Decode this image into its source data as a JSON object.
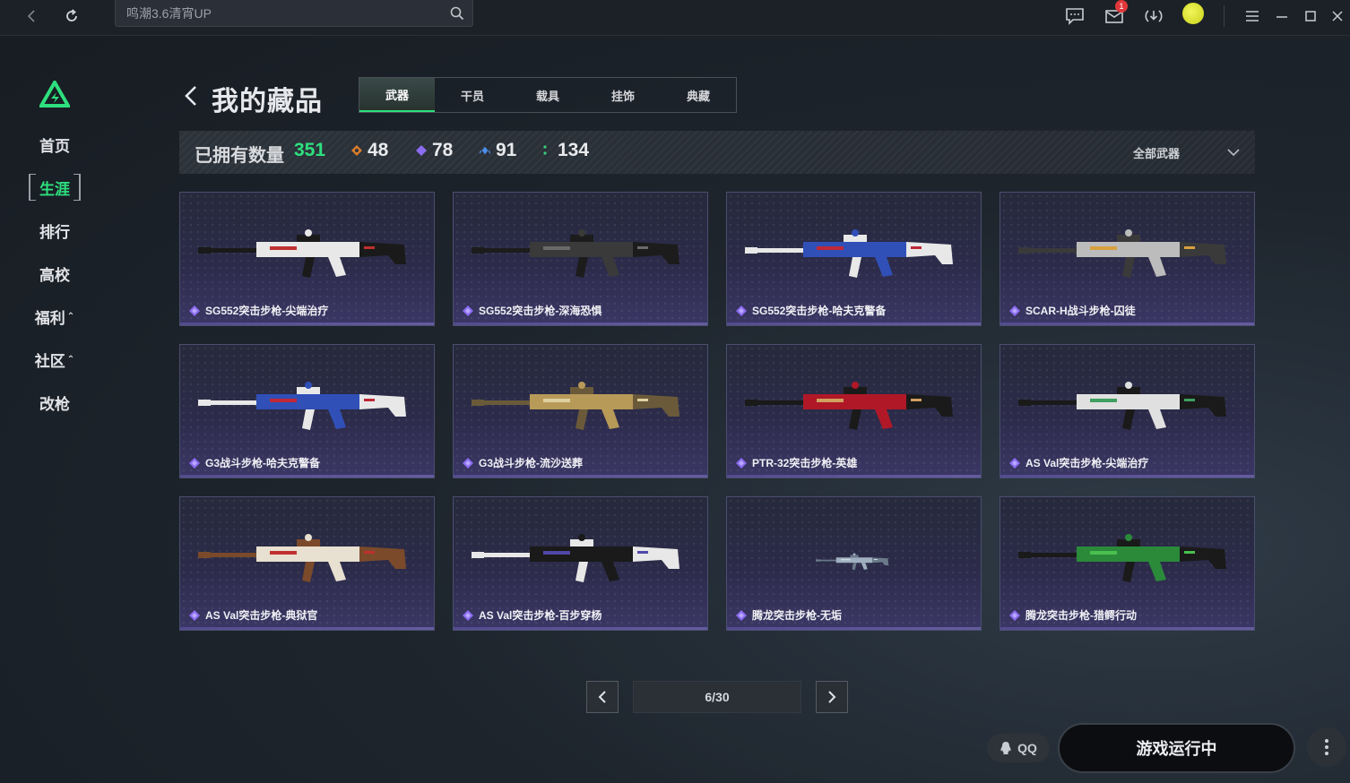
{
  "topbar": {
    "search_value": "鸣潮3.6清宵UP",
    "notification_count": "1",
    "icons": [
      "back-arrow-icon",
      "refresh-icon",
      "search-icon",
      "chat-icon",
      "mail-icon",
      "download-icon",
      "avatar",
      "menu-icon",
      "minimize-icon",
      "maximize-icon",
      "close-icon"
    ]
  },
  "sidebar": {
    "items": [
      {
        "label": "首页",
        "active": false,
        "caret": ""
      },
      {
        "label": "生涯",
        "active": true,
        "caret": ""
      },
      {
        "label": "排行",
        "active": false,
        "caret": ""
      },
      {
        "label": "高校",
        "active": false,
        "caret": ""
      },
      {
        "label": "福利",
        "active": false,
        "caret": "⌃"
      },
      {
        "label": "社区",
        "active": false,
        "caret": "⌃"
      },
      {
        "label": "改枪",
        "active": false,
        "caret": ""
      }
    ]
  },
  "header": {
    "title": "我的藏品",
    "tabs": [
      "武器",
      "干员",
      "载具",
      "挂饰",
      "典藏"
    ],
    "active_tab": "武器"
  },
  "stats": {
    "owned_label": "已拥有数量",
    "owned_total": "351",
    "counts": [
      {
        "value": "48",
        "color": "#d87c2a"
      },
      {
        "value": "78",
        "color": "#8c6cf0"
      },
      {
        "value": "91",
        "color": "#4a8ee8"
      },
      {
        "value": "134",
        "color": "#35d07a"
      }
    ],
    "filter_label": "全部武器"
  },
  "items": [
    {
      "name": "SG552突击步枪-尖端治疗",
      "colors": [
        "#e8e8e8",
        "#1a1a1a",
        "#c03030"
      ]
    },
    {
      "name": "SG552突击步枪-深海恐惧",
      "colors": [
        "#3a3a3a",
        "#1c1c1c",
        "#6a6a6a"
      ]
    },
    {
      "name": "SG552突击步枪-哈夫克警备",
      "colors": [
        "#3050b8",
        "#e8e8e8",
        "#c02838"
      ]
    },
    {
      "name": "SCAR-H战斗步枪-囚徒",
      "colors": [
        "#bcbcbc",
        "#3a3a3a",
        "#d8a040"
      ]
    },
    {
      "name": "G3战斗步枪-哈夫克警备",
      "colors": [
        "#3050b8",
        "#e8e8e8",
        "#c02838"
      ]
    },
    {
      "name": "G3战斗步枪-流沙送葬",
      "colors": [
        "#b89a58",
        "#6a5a3a",
        "#e0d0a0"
      ]
    },
    {
      "name": "PTR-32突击步枪-英雄",
      "colors": [
        "#b01828",
        "#1a1a1a",
        "#d0a060"
      ]
    },
    {
      "name": "AS Val突击步枪-尖端治疗",
      "colors": [
        "#e0e0e0",
        "#1a1a1a",
        "#40a060"
      ]
    },
    {
      "name": "AS Val突击步枪-典狱官",
      "colors": [
        "#e8e0d0",
        "#7a4a2a",
        "#c03030"
      ]
    },
    {
      "name": "AS Val突击步枪-百步穿杨",
      "colors": [
        "#1a1a1a",
        "#e8e8e8",
        "#5048a8"
      ]
    },
    {
      "name": "腾龙突击步枪-无垢",
      "colors": [
        "#a0b0c0",
        "#6a7a8a",
        "#d0d8e0"
      ]
    },
    {
      "name": "腾龙突击步枪-猎鳄行动",
      "colors": [
        "#2a8a3a",
        "#1a1a1a",
        "#4ac050"
      ]
    }
  ],
  "pagination": {
    "current": "6/30"
  },
  "bottom": {
    "qq_label": "QQ",
    "launch_label": "游戏运行中"
  },
  "accent_color": "#2ee07e",
  "rarity_color": "#8c6cf0"
}
